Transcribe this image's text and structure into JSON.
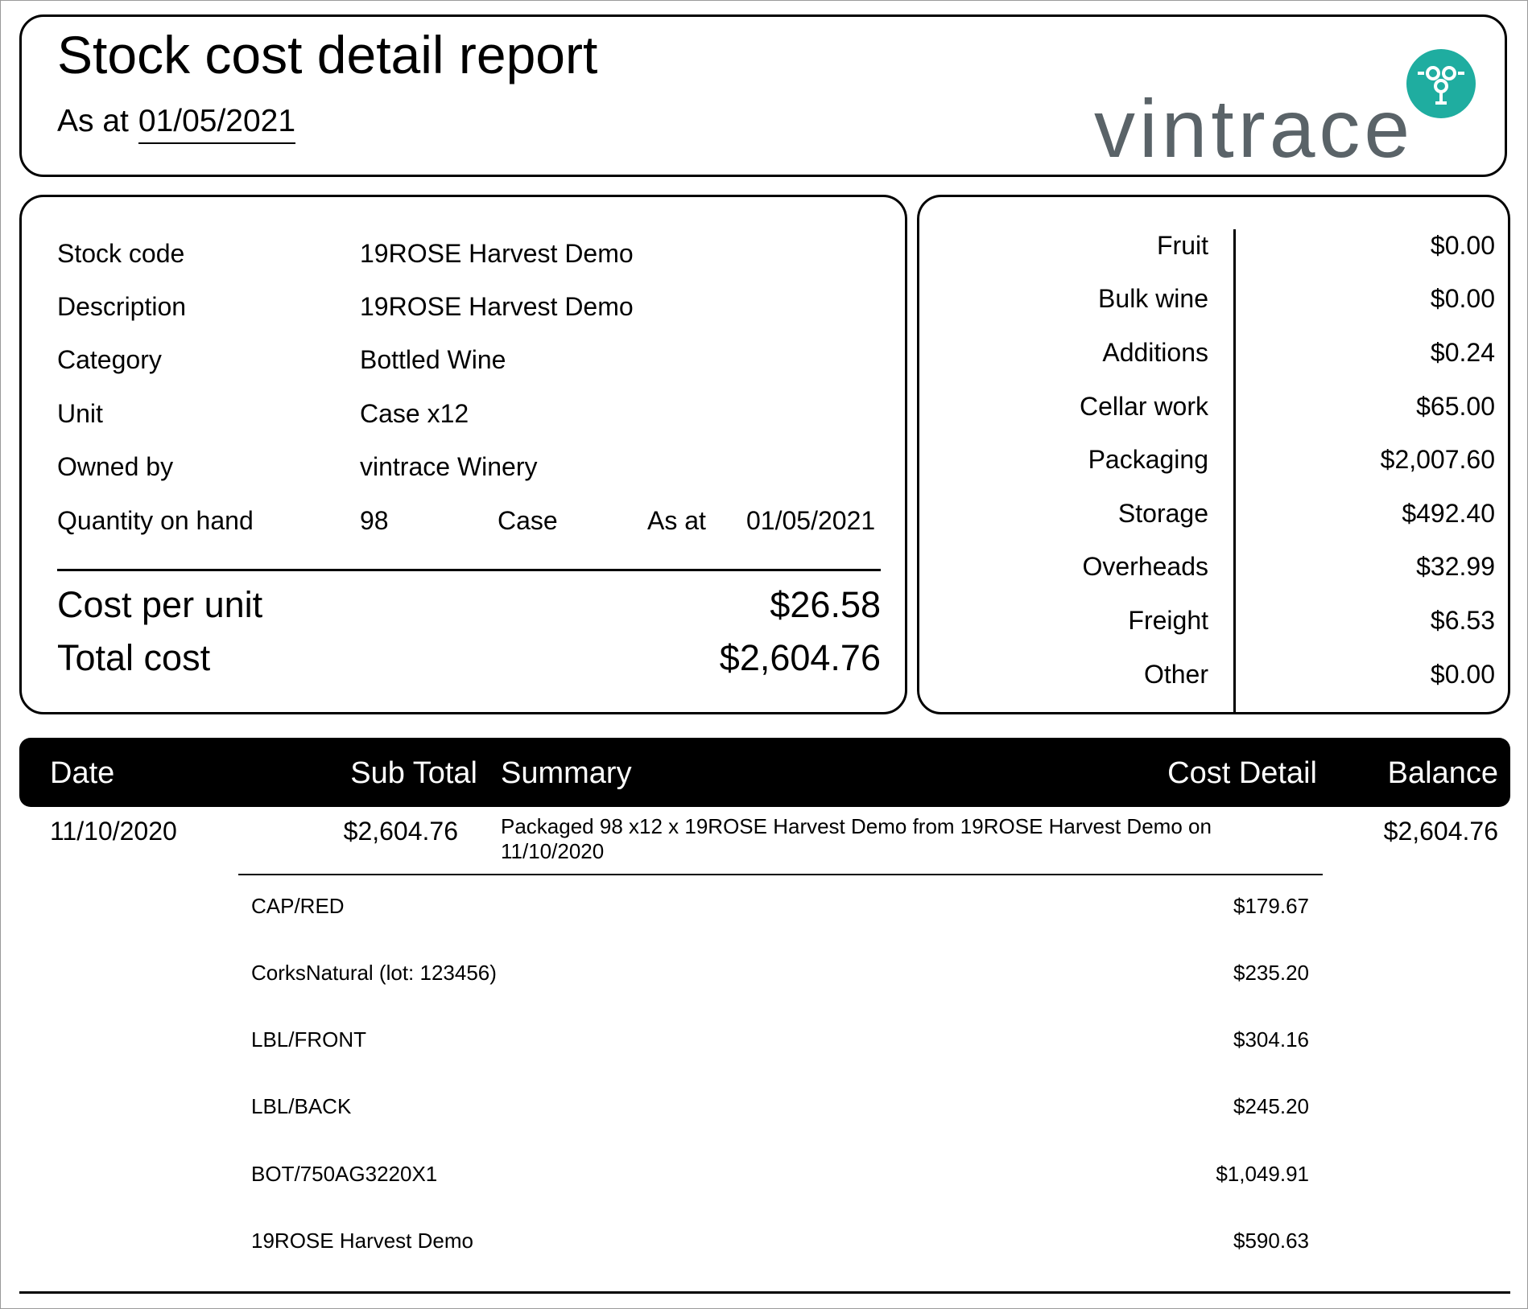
{
  "header": {
    "title": "Stock cost detail report",
    "as_at_label": "As at",
    "as_at_date": "01/05/2021",
    "logo_text": "vintrace",
    "accent_color": "#1fada0"
  },
  "stock_info": {
    "rows": [
      {
        "label": "Stock code",
        "value": "19ROSE Harvest Demo"
      },
      {
        "label": "Description",
        "value": "19ROSE Harvest Demo"
      },
      {
        "label": "Category",
        "value": "Bottled Wine"
      },
      {
        "label": "Unit",
        "value": "Case x12"
      },
      {
        "label": "Owned by",
        "value": "vintrace Winery"
      }
    ],
    "quantity": {
      "label": "Quantity on hand",
      "value": "98",
      "unit": "Case",
      "as_at_label": "As at",
      "as_at_date": "01/05/2021"
    },
    "cost_per_unit": {
      "label": "Cost per unit",
      "value": "$26.58"
    },
    "total_cost": {
      "label": "Total cost",
      "value": "$2,604.76"
    }
  },
  "breakdown": [
    {
      "label": "Fruit",
      "value": "$0.00"
    },
    {
      "label": "Bulk wine",
      "value": "$0.00"
    },
    {
      "label": "Additions",
      "value": "$0.24"
    },
    {
      "label": "Cellar work",
      "value": "$65.00"
    },
    {
      "label": "Packaging",
      "value": "$2,007.60"
    },
    {
      "label": "Storage",
      "value": "$492.40"
    },
    {
      "label": "Overheads",
      "value": "$32.99"
    },
    {
      "label": "Freight",
      "value": "$6.53"
    },
    {
      "label": "Other",
      "value": "$0.00"
    }
  ],
  "table": {
    "columns": {
      "date": "Date",
      "sub_total": "Sub Total",
      "summary": "Summary",
      "cost_detail": "Cost Detail",
      "balance": "Balance"
    },
    "transactions": [
      {
        "date": "11/10/2020",
        "sub_total": "$2,604.76",
        "summary": "Packaged 98 x12 x 19ROSE Harvest Demo from 19ROSE Harvest Demo on 11/10/2020",
        "balance": "$2,604.76",
        "details": [
          {
            "name": "CAP/RED",
            "amount": "$179.67"
          },
          {
            "name": "CorksNatural (lot: 123456)",
            "amount": "$235.20"
          },
          {
            "name": "LBL/FRONT",
            "amount": "$304.16"
          },
          {
            "name": "LBL/BACK",
            "amount": "$245.20"
          },
          {
            "name": "BOT/750AG3220X1",
            "amount": "$1,049.91"
          },
          {
            "name": "19ROSE Harvest Demo",
            "amount": "$590.63"
          }
        ]
      }
    ]
  }
}
